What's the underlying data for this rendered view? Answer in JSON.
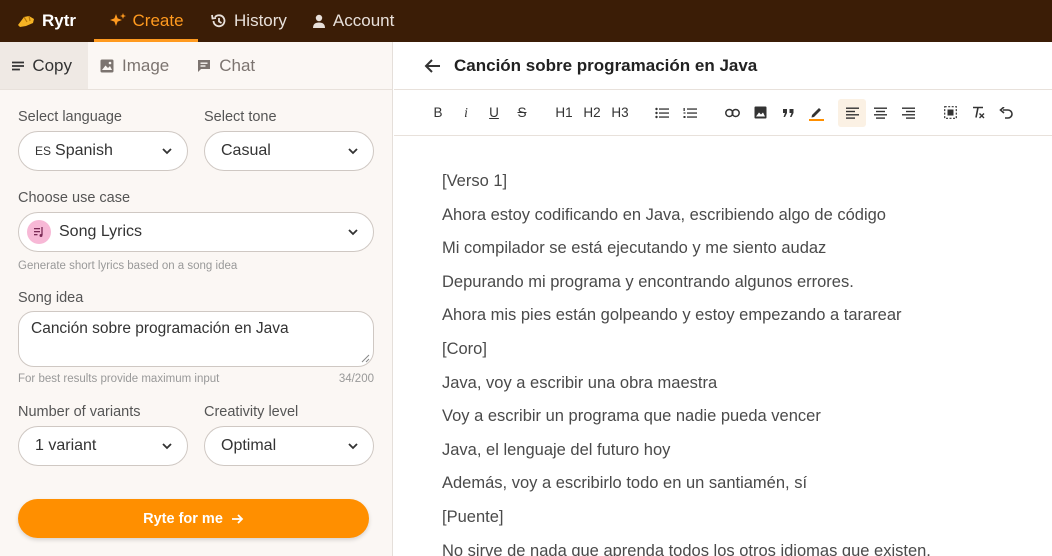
{
  "nav": {
    "logo_label": "Rytr",
    "create_label": "Create",
    "history_label": "History",
    "account_label": "Account"
  },
  "subtabs": {
    "copy": "Copy",
    "image": "Image",
    "chat": "Chat"
  },
  "form": {
    "language_label": "Select language",
    "language_value": "Spanish",
    "language_code": "ES",
    "tone_label": "Select tone",
    "tone_value": "Casual",
    "usecase_label": "Choose use case",
    "usecase_value": "Song Lyrics",
    "usecase_hint": "Generate short lyrics based on a song idea",
    "idea_label": "Song idea",
    "idea_value": "Canción sobre programación en Java",
    "idea_hint": "For best results provide maximum input",
    "idea_count": "34/200",
    "variants_label": "Number of variants",
    "variants_value": "1 variant",
    "creativity_label": "Creativity level",
    "creativity_value": "Optimal",
    "submit_label": "Ryte for me"
  },
  "doc": {
    "title": "Canción sobre programación en Java",
    "toolbar": {
      "h1": "H1",
      "h2": "H2",
      "h3": "H3",
      "bold": "B",
      "italic": "i",
      "underline": "U",
      "strike": "S"
    },
    "lines": [
      "[Verso 1]",
      "Ahora estoy codificando en Java, escribiendo algo de código",
      "Mi compilador se está ejecutando y me siento audaz",
      "Depurando mi programa y encontrando algunos errores.",
      "Ahora mis pies están golpeando y estoy empezando a tararear",
      "[Coro]",
      "Java, voy a escribir una obra maestra",
      "Voy a escribir un programa que nadie pueda vencer",
      "Java, el lenguaje del futuro hoy",
      "Además, voy a escribirlo todo en un santiamén, sí",
      "[Puente]",
      "No sirve de nada que aprenda todos los otros idiomas que existen."
    ]
  },
  "colors": {
    "nav_bg": "#3b1d06",
    "accent": "#ff8f00",
    "usecase_badge": "#f7b8d6"
  }
}
